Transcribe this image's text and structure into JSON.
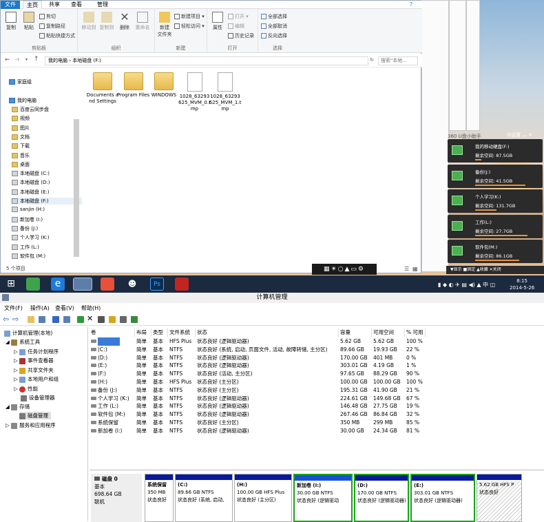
{
  "explorer": {
    "tabs": [
      "文件",
      "主页",
      "共享",
      "查看",
      "管理"
    ],
    "ribbon": {
      "clipboard": {
        "copy": "复制",
        "paste": "粘贴",
        "cut": "剪切",
        "copy_path": "复制路径",
        "paste_shortcut": "粘贴快捷方式",
        "label": "剪贴板"
      },
      "organize": {
        "move_to": "移动到",
        "copy_to": "复制到",
        "delete": "删除",
        "rename": "重命名",
        "label": "组织"
      },
      "new": {
        "new_folder": "新建\n文件夹",
        "new_item": "新建项目",
        "easy_access": "轻松访问",
        "label": "新建"
      },
      "open": {
        "properties": "属性",
        "open": "打开",
        "edit": "编辑",
        "history": "历史记录",
        "label": "打开"
      },
      "select": {
        "select_all": "全部选择",
        "select_none": "全部取消",
        "invert": "反向选择",
        "label": "选择"
      }
    },
    "address": {
      "path": "我的电脑  ›  本地磁盘 (F:)",
      "search_placeholder": "搜索\"本地...",
      "search_right": "备份"
    },
    "nav": {
      "homegroup": "家庭组",
      "my_computer": "我的电脑",
      "items": [
        "百度云同步盘",
        "视频",
        "图片",
        "文档",
        "下载",
        "音乐",
        "桌面",
        "本地磁盘 (C:)",
        "本地磁盘 (D:)",
        "本地磁盘 (E:)",
        "本地磁盘 (F:)",
        "sanjin (H:)",
        "新加卷 (I:)",
        "备份 (J:)",
        "个人学习 (K:)",
        "工作 (L:)",
        "软件包 (M:)"
      ]
    },
    "files": [
      {
        "name": "Documents and Settings",
        "kind": "folder"
      },
      {
        "name": "Program Files",
        "kind": "folder"
      },
      {
        "name": "WINDOWS",
        "kind": "folder"
      },
      {
        "name": "1028_63293625_MVM_0.tmp",
        "kind": "file"
      },
      {
        "name": "1028_63293625_MVM_1.tmp",
        "kind": "file"
      }
    ],
    "status": "5 个项目"
  },
  "widget": {
    "header_360": "360 U盘小助手",
    "settings": "设置",
    "drives": [
      {
        "name": "我的移动硬盘(F:)",
        "free": "剩余空间: 87.5GB",
        "fill": 0.1
      },
      {
        "name": "备份(J:)",
        "free": "剩余空间: 41.5GB",
        "fill": 0.78
      },
      {
        "name": "个人学习(K:)",
        "free": "剩余空间: 131.7GB",
        "fill": 0.33
      },
      {
        "name": "工作(L:)",
        "free": "剩余空间: 27.7GB",
        "fill": 0.81
      },
      {
        "name": "软件包(M:)",
        "free": "剩余空间: 86.1GB",
        "fill": 0.68
      }
    ],
    "footer": "▼显示  ■固定  ▲收藏  ✕关闭"
  },
  "taskbar": {
    "time": "8:15",
    "date": "2014-5-26"
  },
  "compmgmt": {
    "title": "计算机管理",
    "menu": [
      "文件(F)",
      "操作(A)",
      "查看(V)",
      "帮助(H)"
    ],
    "tree": {
      "root": "计算机管理(本地)",
      "system_tools": "系统工具",
      "task_scheduler": "任务计划程序",
      "event_viewer": "事件查看器",
      "shared_folders": "共享文件夹",
      "local_users": "本地用户和组",
      "performance": "性能",
      "device_manager": "设备管理器",
      "storage": "存储",
      "disk_management": "磁盘管理",
      "services": "服务和应用程序"
    },
    "columns": [
      "卷",
      "布局",
      "类型",
      "文件系统",
      "状态",
      "容量",
      "可用空间",
      "% 可用"
    ],
    "volumes": [
      [
        "",
        "简单",
        "基本",
        "HFS Plus",
        "状态良好 (逻辑驱动器)",
        "5.62 GB",
        "5.62 GB",
        "100 %"
      ],
      [
        "(C:)",
        "简单",
        "基本",
        "NTFS",
        "状态良好 (系统, 启动, 页面文件, 活动, 故障转储, 主分区)",
        "89.66 GB",
        "19.93 GB",
        "22 %"
      ],
      [
        "(D:)",
        "简单",
        "基本",
        "NTFS",
        "状态良好 (逻辑驱动器)",
        "170.00 GB",
        "401 MB",
        "0 %"
      ],
      [
        "(E:)",
        "简单",
        "基本",
        "NTFS",
        "状态良好 (逻辑驱动器)",
        "303.01 GB",
        "4.19 GB",
        "1 %"
      ],
      [
        "(F:)",
        "简单",
        "基本",
        "NTFS",
        "状态良好 (活动, 主分区)",
        "97.65 GB",
        "88.29 GB",
        "90 %"
      ],
      [
        "(H:)",
        "简单",
        "基本",
        "HFS Plus",
        "状态良好 (主分区)",
        "100.00 GB",
        "100.00 GB",
        "100 %"
      ],
      [
        "备份 (J:)",
        "简单",
        "基本",
        "NTFS",
        "状态良好 (主分区)",
        "195.31 GB",
        "41.90 GB",
        "21 %"
      ],
      [
        "个人学习 (K:)",
        "简单",
        "基本",
        "NTFS",
        "状态良好 (逻辑驱动器)",
        "224.61 GB",
        "149.68 GB",
        "67 %"
      ],
      [
        "工作 (L:)",
        "简单",
        "基本",
        "NTFS",
        "状态良好 (逻辑驱动器)",
        "146.48 GB",
        "27.75 GB",
        "19 %"
      ],
      [
        "软件包 (M:)",
        "简单",
        "基本",
        "NTFS",
        "状态良好 (逻辑驱动器)",
        "267.46 GB",
        "86.84 GB",
        "32 %"
      ],
      [
        "系统保留",
        "简单",
        "基本",
        "NTFS",
        "状态良好 (主分区)",
        "350 MB",
        "299 MB",
        "85 %"
      ],
      [
        "新加卷 (I:)",
        "简单",
        "基本",
        "NTFS",
        "状态良好 (逻辑驱动器)",
        "30.00 GB",
        "24.34 GB",
        "81 %"
      ]
    ],
    "disk": {
      "name": "磁盘 0",
      "type": "基本",
      "size": "698.64 GB",
      "status": "联机"
    },
    "partitions": [
      {
        "name": "系统保留",
        "size": "350 MB",
        "status": "状态良好"
      },
      {
        "name": "(C:)",
        "size": "89.66 GB NTFS",
        "status": "状态良好 (系统, 启动,"
      },
      {
        "name": "(H:)",
        "size": "100.00 GB HFS Plus",
        "status": "状态良好 (主分区)"
      },
      {
        "name": "新加卷 (I:)",
        "size": "30.00 GB NTFS",
        "status": "状态良好 (逻辑驱动"
      },
      {
        "name": "(D:)",
        "size": "170.00 GB NTFS",
        "status": "状态良好 (逻辑驱动器)"
      },
      {
        "name": "(E:)",
        "size": "303.01 GB NTFS",
        "status": "状态良好 (逻辑驱动器)"
      },
      {
        "name": "",
        "size": "5.62 GB HFS P",
        "status": "状态良好"
      }
    ]
  }
}
